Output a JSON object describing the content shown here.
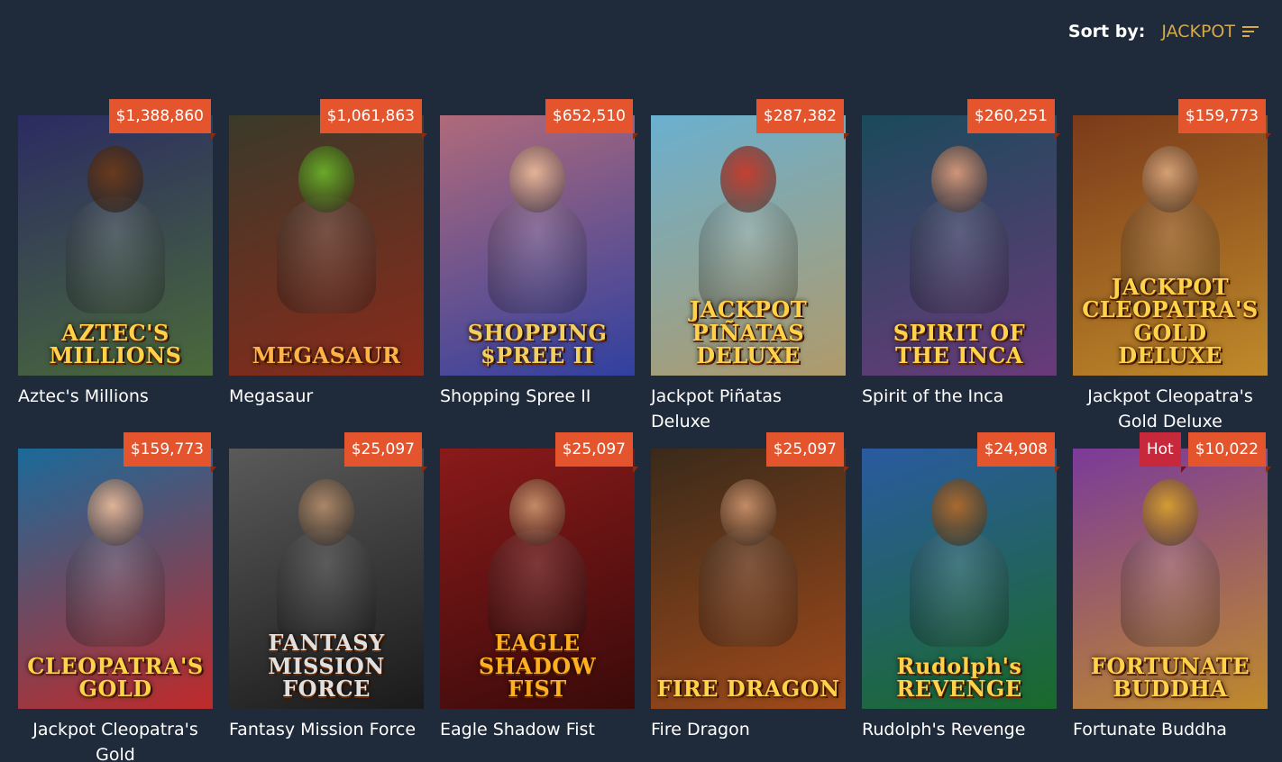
{
  "sort": {
    "label": "Sort by:",
    "value": "JACKPOT",
    "icon": "sort-lines-icon"
  },
  "games": [
    {
      "title": "Aztec's Millions",
      "jackpot": "$1,388,860",
      "logo": "AZTEC'S MILLIONS",
      "bg1": "#2b2b62",
      "bg2": "#4a6a3a",
      "skin": "#6b3a1a",
      "logo_color": "#ffd24a",
      "center": false
    },
    {
      "title": "Megasaur",
      "jackpot": "$1,061,863",
      "logo": "MEGASAUR",
      "bg1": "#3a3a2a",
      "bg2": "#8a2a1a",
      "skin": "#6ab02a",
      "logo_color": "#ffb347",
      "center": false
    },
    {
      "title": "Shopping Spree II",
      "jackpot": "$652,510",
      "logo": "SHOPPING $PREE II",
      "bg1": "#b06a7a",
      "bg2": "#3040a0",
      "skin": "#e8b898",
      "logo_color": "#f0d060",
      "center": false
    },
    {
      "title": "Jackpot Piñatas Deluxe",
      "jackpot": "$287,382",
      "logo": "JACKPOT PIÑATAS DELUXE",
      "bg1": "#6ab0d0",
      "bg2": "#b09a6a",
      "skin": "#c83a2a",
      "logo_color": "#ffd24a",
      "center": false
    },
    {
      "title": "Spirit of the Inca",
      "jackpot": "$260,251",
      "logo": "SPIRIT OF THE INCA",
      "bg1": "#1a4a5a",
      "bg2": "#6a3a7a",
      "skin": "#d89a7a",
      "logo_color": "#ffd24a",
      "center": false
    },
    {
      "title": "Jackpot Cleopatra's Gold Deluxe",
      "jackpot": "$159,773",
      "logo": "JACKPOT CLEOPATRA'S GOLD DELUXE",
      "bg1": "#7a3a1a",
      "bg2": "#c08a2a",
      "skin": "#d8a47a",
      "logo_color": "#ffd24a",
      "center": true
    },
    {
      "title": "Jackpot Cleopatra's Gold",
      "jackpot": "$159,773",
      "logo": "CLEOPATRA'S GOLD",
      "bg1": "#1a6a9a",
      "bg2": "#c02a2a",
      "skin": "#e8b898",
      "logo_color": "#ffd24a",
      "center": true
    },
    {
      "title": "Fantasy Mission Force",
      "jackpot": "$25,097",
      "logo": "FANTASY MISSION FORCE",
      "bg1": "#5a5a5a",
      "bg2": "#1a1a1a",
      "skin": "#b08a6a",
      "logo_color": "#e0e0e0",
      "center": false
    },
    {
      "title": "Eagle Shadow Fist",
      "jackpot": "$25,097",
      "logo": "EAGLE SHADOW FIST",
      "bg1": "#8a1a1a",
      "bg2": "#3a0a0a",
      "skin": "#c8906a",
      "logo_color": "#ffb020",
      "center": false
    },
    {
      "title": "Fire Dragon",
      "jackpot": "$25,097",
      "logo": "FIRE DRAGON",
      "bg1": "#3a2a1a",
      "bg2": "#a04a1a",
      "skin": "#c8906a",
      "logo_color": "#ffd24a",
      "center": false
    },
    {
      "title": "Rudolph's Revenge",
      "jackpot": "$24,908",
      "logo": "Rudolph's REVENGE",
      "bg1": "#2a5aa0",
      "bg2": "#1a6a2a",
      "skin": "#b06a2a",
      "logo_color": "#ffd24a",
      "center": false
    },
    {
      "title": "Fortunate Buddha",
      "jackpot": "$10,022",
      "hot": "Hot",
      "logo": "FORTUNATE BUDDHA",
      "bg1": "#7a3a9a",
      "bg2": "#c08a2a",
      "skin": "#d8a030",
      "logo_color": "#ffd24a",
      "center": false
    }
  ]
}
